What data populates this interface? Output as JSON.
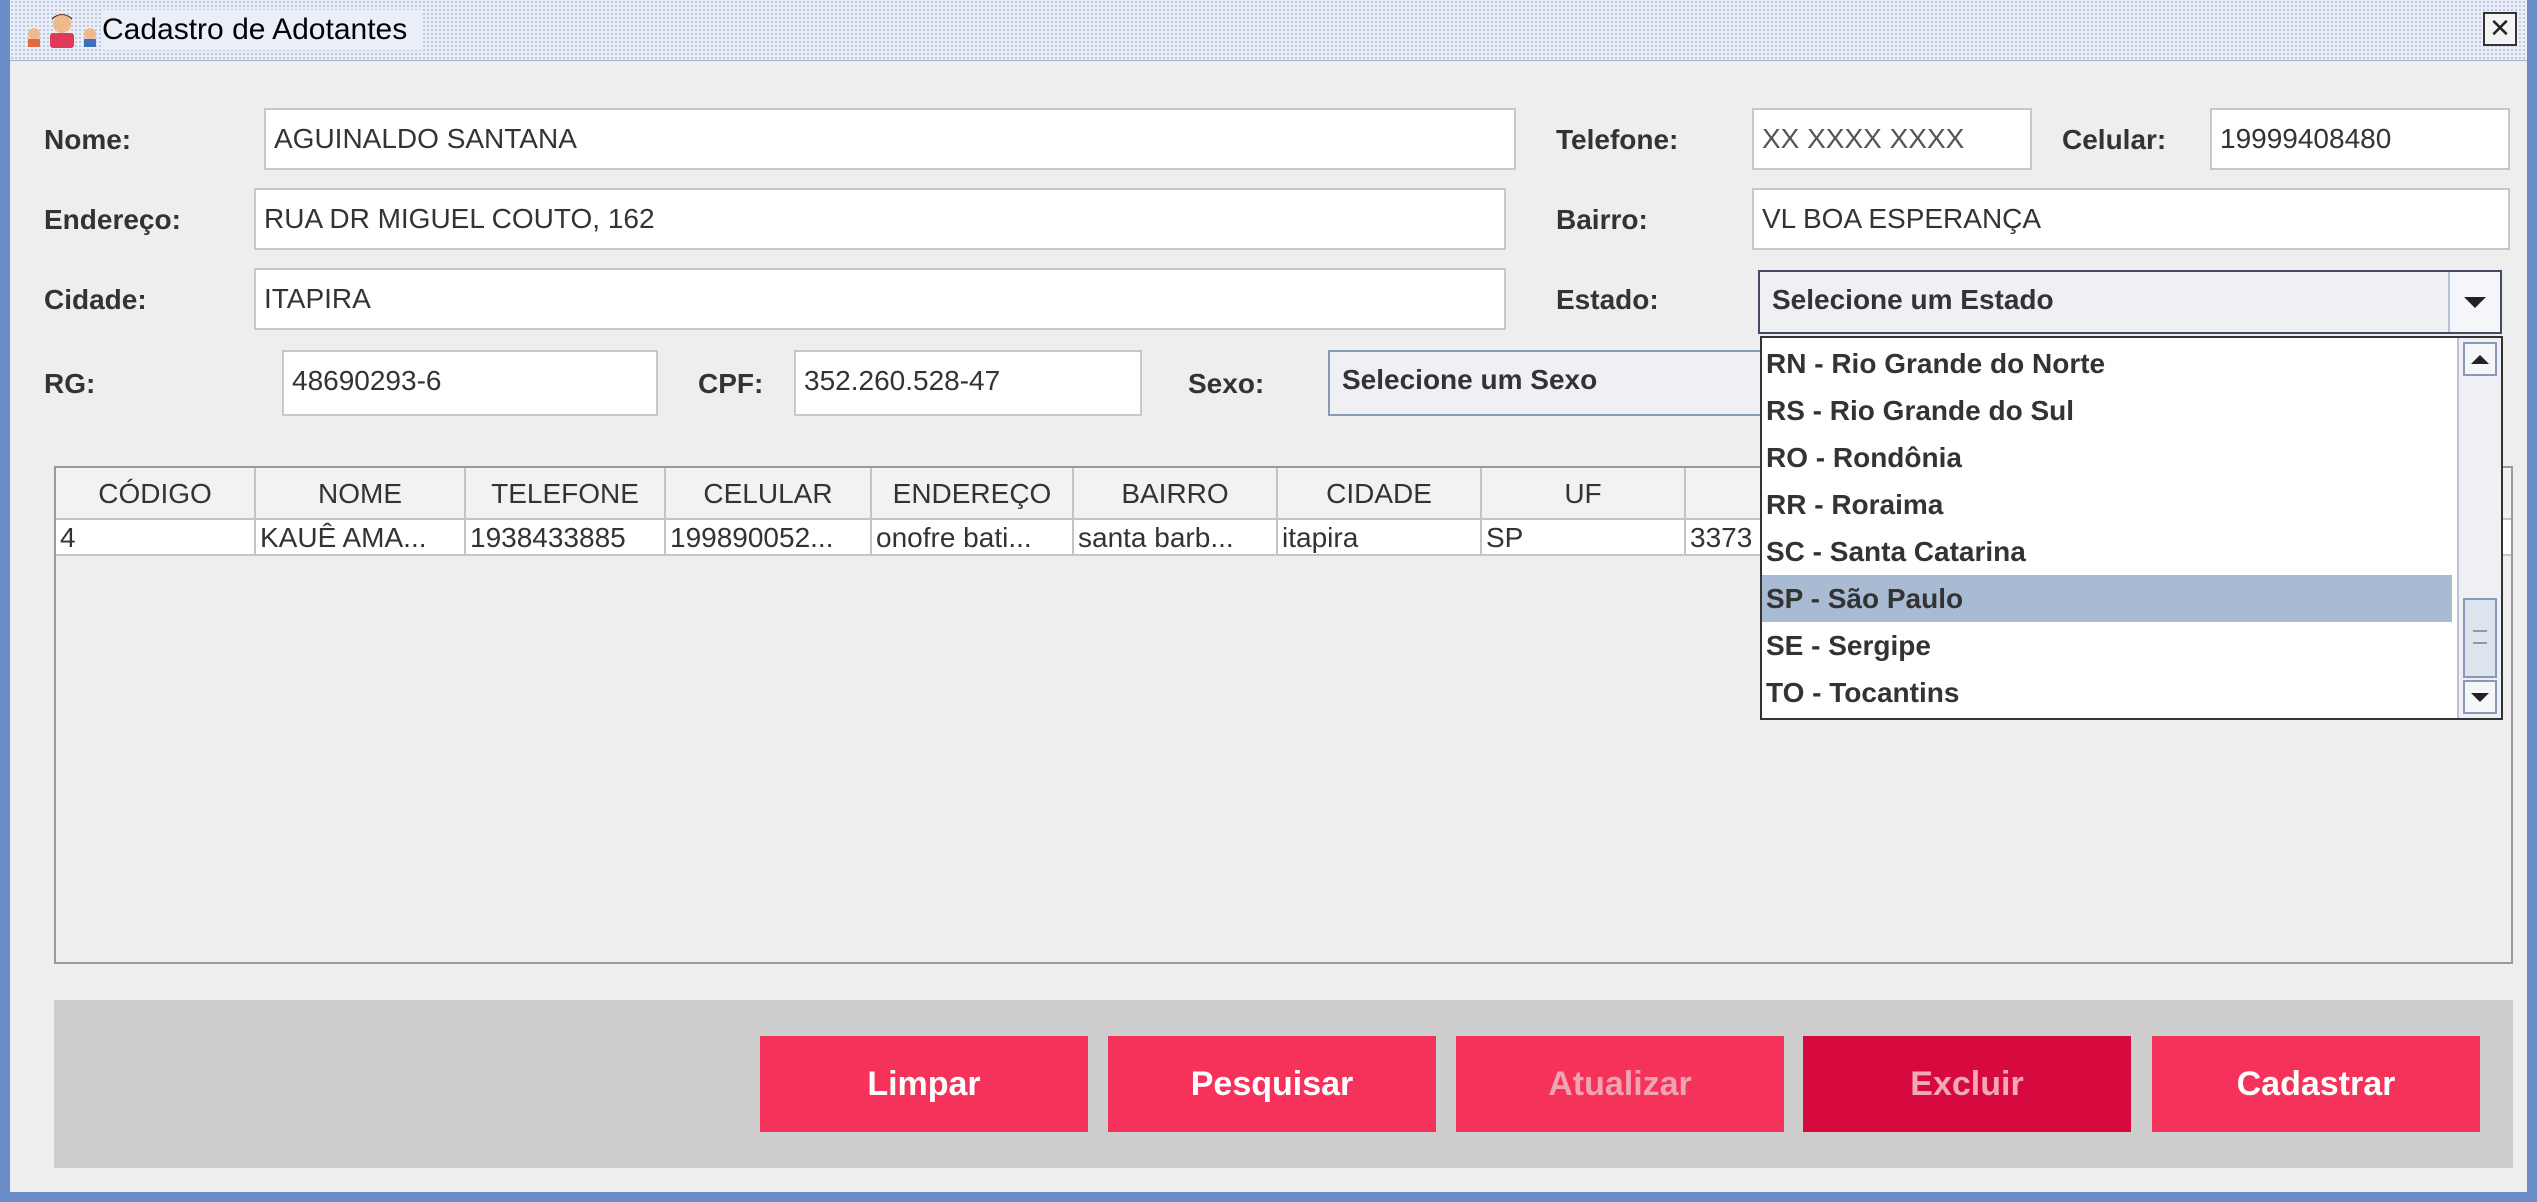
{
  "window": {
    "title": "Cadastro de Adotantes",
    "icon": "people-icon"
  },
  "form": {
    "nome_label": "Nome:",
    "nome_value": "AGUINALDO SANTANA",
    "telefone_label": "Telefone:",
    "telefone_value": "XX XXXX XXXX",
    "celular_label": "Celular:",
    "celular_value": "19999408480",
    "endereco_label": "Endereço:",
    "endereco_value": "RUA DR MIGUEL COUTO, 162",
    "bairro_label": "Bairro:",
    "bairro_value": "VL BOA ESPERANÇA",
    "cidade_label": "Cidade:",
    "cidade_value": "ITAPIRA",
    "estado_label": "Estado:",
    "estado_value": "Selecione um Estado",
    "rg_label": "RG:",
    "rg_value": "48690293-6",
    "cpf_label": "CPF:",
    "cpf_value": "352.260.528-47",
    "sexo_label": "Sexo:",
    "sexo_value": "Selecione um Sexo"
  },
  "estado_dropdown": {
    "options": [
      "RN - Rio Grande do Norte",
      "RS - Rio Grande do Sul",
      "RO - Rondônia",
      "RR - Roraima",
      "SC - Santa Catarina",
      "SP - São Paulo",
      "SE - Sergipe",
      "TO - Tocantins"
    ],
    "highlighted": "SP - São Paulo"
  },
  "table": {
    "columns": [
      "CÓDIGO",
      "NOME",
      "TELEFONE",
      "CELULAR",
      "ENDEREÇO",
      "BAIRRO",
      "CIDADE",
      "UF",
      ""
    ],
    "rows": [
      [
        "4",
        "KAUÊ AMA...",
        "1938433885",
        "199890052...",
        "onofre bati...",
        "santa barb...",
        "itapira",
        "SP",
        "3373"
      ]
    ]
  },
  "buttons": {
    "limpar": "Limpar",
    "pesquisar": "Pesquisar",
    "atualizar": "Atualizar",
    "excluir": "Excluir",
    "cadastrar": "Cadastrar"
  },
  "colors": {
    "button": "#f4325a",
    "button_pressed": "#d60a3f",
    "selection": "#a9bbd3"
  }
}
